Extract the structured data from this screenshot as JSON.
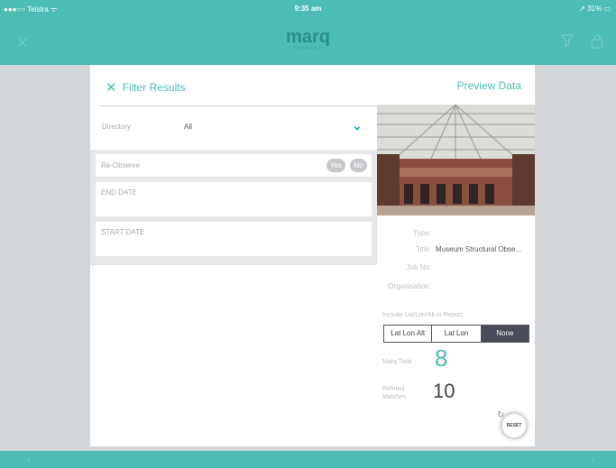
{
  "status_bar": {
    "carrier": "●●●○○ Telstra ᯤ",
    "time": "9:35 am",
    "battery": "➚ 31% ▭"
  },
  "app": {
    "logo": "marq",
    "logo_sub": "CONNECT"
  },
  "header": {
    "filter_title": "Filter Results",
    "preview_link": "Preview Data"
  },
  "filters": {
    "directory_label": "Directory",
    "directory_value": "All",
    "reobserve_label": "Re-Observe",
    "yes_label": "Yes",
    "no_label": "No",
    "end_date_label": "END DATE",
    "start_date_label": "START DATE"
  },
  "details": {
    "type_label": "Type:",
    "type_value": "",
    "title_label": "Title:",
    "title_value": "Museum Structural Obse...",
    "job_label": "Job No:",
    "job_value": "",
    "org_label": "Organisation:",
    "org_value": ""
  },
  "report": {
    "include_label": "Include Lat/Lon/Alt in Report:",
    "options": [
      "Lat Lon Alt",
      "Lat Lon",
      "None"
    ],
    "selected": "None"
  },
  "stats": {
    "total_label": "Marq Total",
    "total_value": "8",
    "refined_label": "Refined Matches",
    "refined_value": "10"
  },
  "reset_label": "RESET",
  "colors": {
    "accent": "#4dbcb4",
    "dark_segment": "#4a4b58",
    "chevron": "#1fa6d8"
  },
  "icons": [
    "close-icon",
    "filter-icon",
    "lock-icon",
    "chevron-down-icon",
    "reset-icon",
    "prev-arrow-icon",
    "next-arrow-icon"
  ]
}
